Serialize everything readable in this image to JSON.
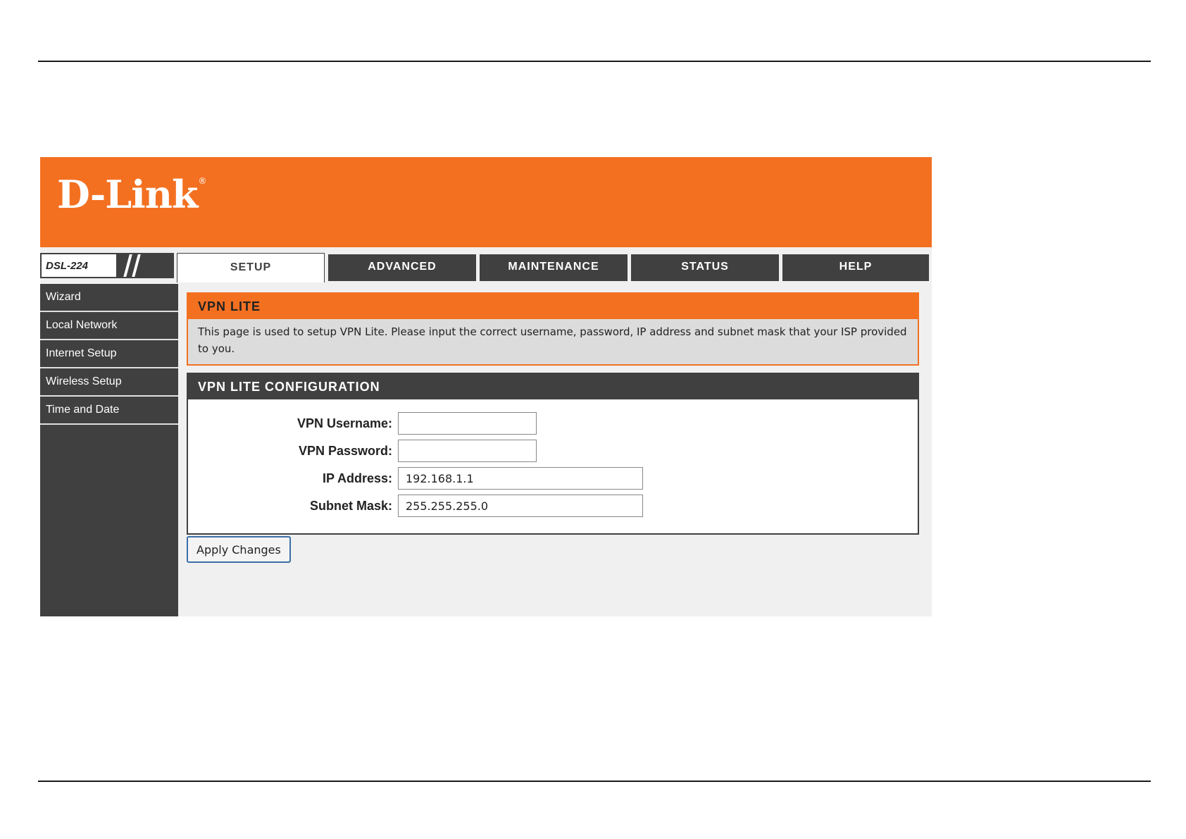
{
  "brand": {
    "logo_text": "D-Link",
    "logo_mark": "®",
    "model": "DSL-224"
  },
  "tabs": [
    {
      "label": "SETUP",
      "active": true
    },
    {
      "label": "ADVANCED",
      "active": false
    },
    {
      "label": "MAINTENANCE",
      "active": false
    },
    {
      "label": "STATUS",
      "active": false
    },
    {
      "label": "HELP",
      "active": false
    }
  ],
  "sidebar": {
    "items": [
      {
        "label": "Wizard"
      },
      {
        "label": "Local Network"
      },
      {
        "label": "Internet Setup"
      },
      {
        "label": "Wireless Setup"
      },
      {
        "label": "Time and Date"
      }
    ]
  },
  "info": {
    "title": "VPN LITE",
    "text": "This page is used to setup VPN Lite. Please input the correct username, password, IP address and subnet mask that your ISP provided to you."
  },
  "config": {
    "title": "VPN LITE CONFIGURATION",
    "fields": {
      "username": {
        "label": "VPN Username:",
        "value": ""
      },
      "password": {
        "label": "VPN Password:",
        "value": ""
      },
      "ip_address": {
        "label": "IP Address:",
        "value": "192.168.1.1"
      },
      "subnet_mask": {
        "label": "Subnet Mask:",
        "value": "255.255.255.0"
      }
    }
  },
  "actions": {
    "apply_label": "Apply Changes"
  },
  "colors": {
    "accent_orange": "#f37021",
    "dark_gray": "#404040",
    "panel_bg": "#f0f0f0"
  }
}
